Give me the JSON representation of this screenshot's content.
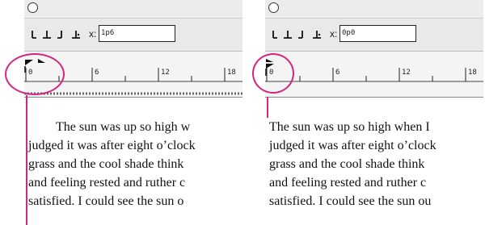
{
  "panels": [
    {
      "id": "left",
      "x_label": "x:",
      "x_value": "1p6",
      "ruler_numbers": [
        "0",
        "6",
        "12",
        "18"
      ],
      "indent": "first-line",
      "text_lines": [
        "The sun was up so high w",
        "judged it was after eight o’clock",
        "grass and the cool shade think",
        "and feeling rested and ruther c",
        "satisfied. I could see the sun o"
      ]
    },
    {
      "id": "right",
      "x_label": "x:",
      "x_value": "0p0",
      "ruler_numbers": [
        "0",
        "6",
        "12",
        "18"
      ],
      "indent": "none",
      "text_lines": [
        "The sun was up so high when I",
        "judged it was after eight o’clock",
        "grass and the cool shade think",
        "and feeling rested and ruther c",
        "satisfied. I could see the sun ou"
      ]
    }
  ],
  "colors": {
    "highlight": "#d4267f",
    "ruler_bg": "#f4f4f4",
    "toolbar_bg": "#e9e9e9"
  },
  "toolbar_icons": [
    "left-justified-tab-icon",
    "center-justified-tab-icon",
    "right-justified-tab-icon",
    "align-to-decimal-tab-icon"
  ]
}
